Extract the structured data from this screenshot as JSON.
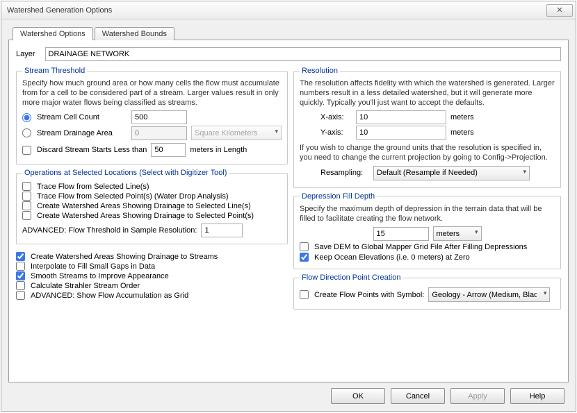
{
  "window": {
    "title": "Watershed Generation Options",
    "close_glyph": "✕"
  },
  "tabs": {
    "active": "Watershed Options",
    "inactive": "Watershed Bounds"
  },
  "layer": {
    "label": "Layer",
    "value": "DRAINAGE NETWORK"
  },
  "stream_threshold": {
    "legend": "Stream Threshold",
    "desc": "Specify how much ground area or how many cells the flow must accumulate from for a cell to be considered part of a stream. Larger values result in only more major water flows being classified as streams.",
    "cell_count_label": "Stream Cell Count",
    "cell_count_value": "500",
    "drainage_area_label": "Stream Drainage Area",
    "drainage_area_value": "0",
    "area_units": "Square Kilometers",
    "discard_label_a": "Discard Stream Starts Less than",
    "discard_value": "50",
    "discard_label_b": "meters in Length"
  },
  "operations": {
    "legend": "Operations at Selected Locations (Select with Digitizer Tool)",
    "opt1": "Trace Flow from Selected Line(s)",
    "opt2": "Trace Flow from Selected Point(s) (Water Drop Analysis)",
    "opt3": "Create Watershed Areas Showing Drainage to Selected Line(s)",
    "opt4": "Create Watershed Areas Showing Drainage to Selected Point(s)",
    "adv_label": "ADVANCED: Flow Threshold in Sample Resolution:",
    "adv_value": "1"
  },
  "global_opts": {
    "o1": "Create Watershed Areas Showing Drainage to Streams",
    "o2": "Interpolate to Fill Small Gaps in Data",
    "o3": "Smooth Streams to Improve Appearance",
    "o4": "Calculate Strahler Stream Order",
    "o5": "ADVANCED: Show Flow Accumulation as Grid"
  },
  "resolution": {
    "legend": "Resolution",
    "desc": "The resolution affects fidelity with which the watershed is generated. Larger numbers result in a less detailed watershed, but it will generate more quickly. Typically you'll just want to accept the defaults.",
    "x_label": "X-axis:",
    "x_value": "10",
    "x_units": "meters",
    "y_label": "Y-axis:",
    "y_value": "10",
    "y_units": "meters",
    "note": "If you wish to change the ground units that the resolution is specified in, you need to change the current projection by going to Config->Projection.",
    "resampling_label": "Resampling:",
    "resampling_value": "Default (Resample if Needed)"
  },
  "depression": {
    "legend": "Depression Fill Depth",
    "desc": "Specify the maximum depth of depression in the terrain data that will be filled to facilitate creating the flow network.",
    "depth_value": "15",
    "depth_units": "meters",
    "save_dem": "Save DEM to Global Mapper Grid File After Filling Depressions",
    "keep_ocean": "Keep Ocean Elevations (i.e. 0 meters) at Zero"
  },
  "flowdir": {
    "legend": "Flow Direction Point Creation",
    "create_label": "Create Flow Points with Symbol:",
    "symbol_value": "Geology - Arrow (Medium, Black)"
  },
  "buttons": {
    "ok": "OK",
    "cancel": "Cancel",
    "apply": "Apply",
    "help": "Help"
  }
}
